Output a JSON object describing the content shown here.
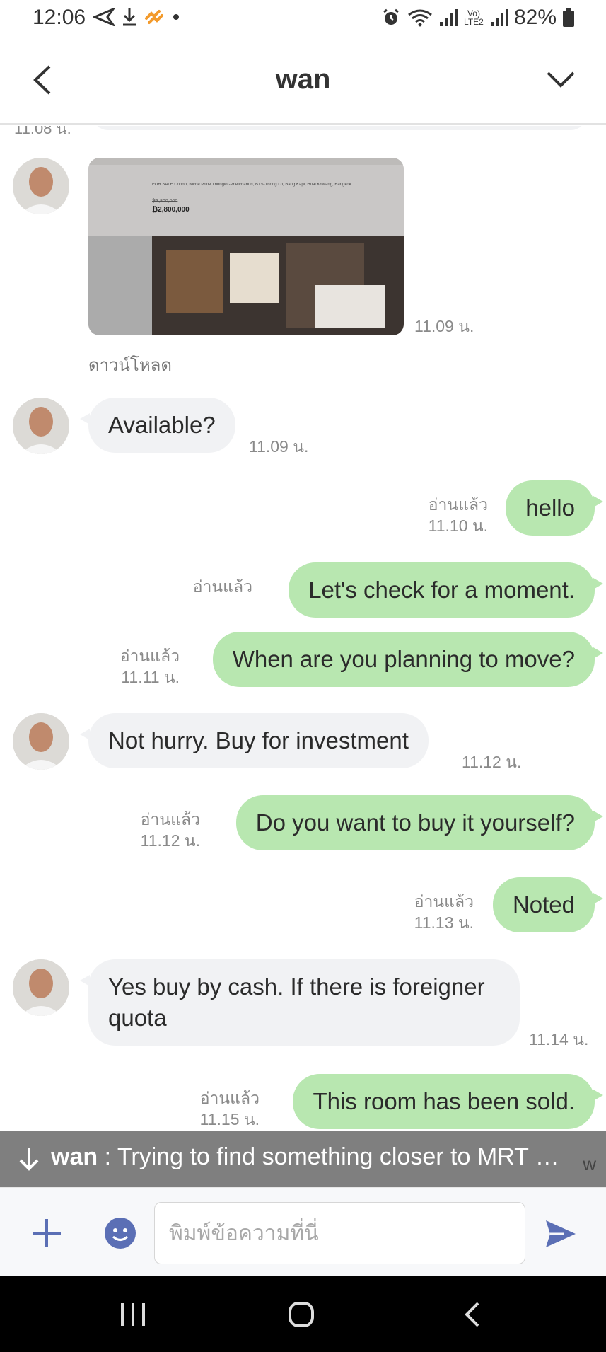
{
  "status_bar": {
    "time": "12:06",
    "battery_text": "82%",
    "network_label": "Vo) LTE2",
    "icons": [
      "send-arrow-icon",
      "download-icon",
      "app-badge-icon",
      "dot-icon",
      "alarm-icon",
      "wifi-icon",
      "signal-icon",
      "battery-icon"
    ]
  },
  "header": {
    "title": "wan",
    "back_icon": "chevron-left-icon",
    "menu_icon": "chevron-down-icon"
  },
  "chat": {
    "cut_off_time": "11.08 น.",
    "messages": [
      {
        "type": "image",
        "direction": "in",
        "time": "11.09 น.",
        "caption": "ดาวน์โหลด",
        "image_text": {
          "line1": "FOR SALE Condo, Niche Pride Thonglor-Phetchaburi, BTS-Thong Lo, Bang Kapi, Huai Khwang, Bangkok",
          "strike_price": "₿3,800,000",
          "price": "₿2,800,000"
        }
      },
      {
        "type": "text",
        "direction": "in",
        "text": "Available?",
        "time": "11.09 น."
      },
      {
        "type": "text",
        "direction": "out",
        "text": "hello",
        "read": "อ่านแล้ว",
        "time": "11.10 น."
      },
      {
        "type": "text",
        "direction": "out",
        "text": "Let's check for a moment.",
        "read": "อ่านแล้ว",
        "time": ""
      },
      {
        "type": "text",
        "direction": "out",
        "text": "When are you planning to move?",
        "read": "อ่านแล้ว",
        "time": "11.11 น."
      },
      {
        "type": "text",
        "direction": "in",
        "text": "Not hurry. Buy for investment",
        "time": "11.12 น."
      },
      {
        "type": "text",
        "direction": "out",
        "text": "Do you want to buy it yourself?",
        "read": "อ่านแล้ว",
        "time": "11.12 น."
      },
      {
        "type": "text",
        "direction": "out",
        "text": "Noted",
        "read": "อ่านแล้ว",
        "time": "11.13 น."
      },
      {
        "type": "text",
        "direction": "in",
        "text": "Yes buy by cash. If there is foreigner quota",
        "time": "11.14 น."
      },
      {
        "type": "text",
        "direction": "out",
        "text": "This room has been sold.",
        "read": "อ่านแล้ว",
        "time": "11.15 น."
      }
    ]
  },
  "preview": {
    "sender": "wan",
    "separator": " : ",
    "text": "Trying to find something closer to MRT …",
    "tail": "w"
  },
  "input": {
    "placeholder": "พิมพ์ข้อความที่นี่",
    "value": ""
  },
  "colors": {
    "outgoing_bubble": "#b8e7b0",
    "incoming_bubble": "#f1f2f4",
    "accent": "#5b6fb5",
    "preview_bar": "#7f7f7f"
  }
}
